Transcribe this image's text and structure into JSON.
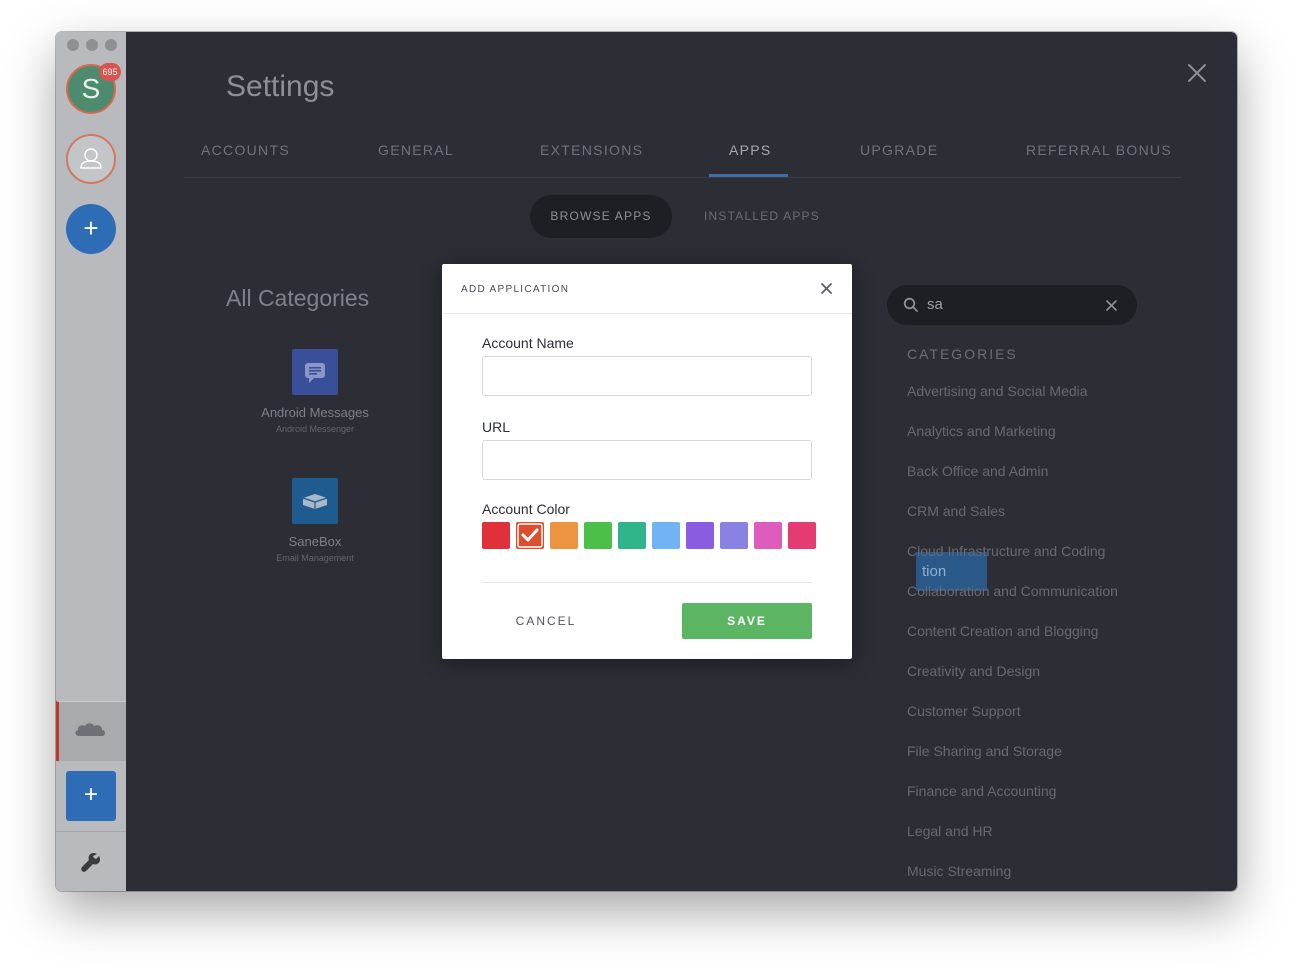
{
  "sidebar": {
    "account_initial": "S",
    "badge_count": "695",
    "icons": [
      "user-icon",
      "plus-icon",
      "salesforce-icon",
      "plus-icon",
      "wrench-icon"
    ]
  },
  "settings": {
    "title": "Settings",
    "tabs": [
      {
        "label": "ACCOUNTS"
      },
      {
        "label": "GENERAL"
      },
      {
        "label": "EXTENSIONS"
      },
      {
        "label": "APPS",
        "active": true
      },
      {
        "label": "UPGRADE"
      },
      {
        "label": "REFERRAL BONUS"
      }
    ],
    "subtabs": {
      "browse": "BROWSE APPS",
      "installed": "INSTALLED APPS"
    }
  },
  "browse": {
    "heading": "All Categories",
    "apps": [
      {
        "name": "Android Messages",
        "subtitle": "Android Messenger",
        "icon_color": "#3a4f9a"
      },
      {
        "name": "SaneBox",
        "subtitle": "Email Management",
        "icon_color": "#1f5b8f"
      }
    ],
    "search": {
      "value": "sa"
    },
    "categories_heading": "CATEGORIES",
    "categories": [
      "Advertising and Social Media",
      "Analytics and Marketing",
      "Back Office and Admin",
      "CRM and Sales",
      "Cloud Infrastructure and Coding",
      "Collaboration and Communication",
      "Content Creation and Blogging",
      "Creativity and Design",
      "Customer Support",
      "File Sharing and Storage",
      "Finance and Accounting",
      "Legal and HR",
      "Music Streaming"
    ],
    "background_button_fragment": "tion"
  },
  "modal": {
    "title": "ADD APPLICATION",
    "account_name_label": "Account Name",
    "account_name_value": "",
    "url_label": "URL",
    "url_value": "",
    "color_label": "Account Color",
    "colors": [
      "#e0303a",
      "#dd4e2f",
      "#ec9440",
      "#4bbf48",
      "#30b48c",
      "#72b3f5",
      "#8c5ce0",
      "#8a82e2",
      "#dd5cbc",
      "#e33b72"
    ],
    "selected_color_index": 1,
    "cancel_label": "CANCEL",
    "save_label": "SAVE"
  }
}
